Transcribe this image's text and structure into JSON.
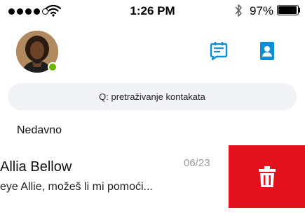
{
  "status_bar": {
    "time": "1:26 PM",
    "battery_percent": "97%",
    "battery_level": 0.97,
    "signal_bars_filled": 4,
    "signal_bars_total": 5,
    "wifi_icon": "wifi-icon",
    "bluetooth_icon": "bluetooth-icon"
  },
  "header": {
    "avatar_presence": "online",
    "presence_color": "#6bb700",
    "new_chat_icon": "new-chat-icon",
    "contacts_icon": "contacts-icon",
    "accent_color": "#0d8fd8"
  },
  "search": {
    "placeholder": "Q: pretraživanje kontakata"
  },
  "section": {
    "label": "Nedavno"
  },
  "conversation": {
    "name": "Allia Bellow",
    "date": "06/23",
    "preview": "eye Allie, možeš li mi pomoći...",
    "delete_icon": "trash-icon",
    "delete_color": "#e3121e"
  }
}
